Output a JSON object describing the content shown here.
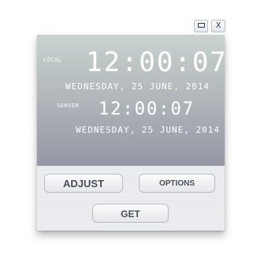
{
  "window_controls": {
    "minimize_icon": "minimize-icon",
    "close_label": "X"
  },
  "clock": {
    "local_label": "LOCAL",
    "local_time": "12:00:07",
    "local_date": "WEDNESDAY, 25 JUNE, 2014",
    "server_label": "SERVER",
    "server_time": "12:00:07",
    "server_date": "WEDNESDAY, 25 JUNE, 2014"
  },
  "buttons": {
    "adjust": "ADJUST",
    "options": "OPTIONS",
    "get": "GET"
  },
  "colors": {
    "display_top": "#c9d3cf",
    "display_bottom": "#9598a5",
    "digit_color": "#ffffff",
    "button_text": "#4a4f55"
  }
}
